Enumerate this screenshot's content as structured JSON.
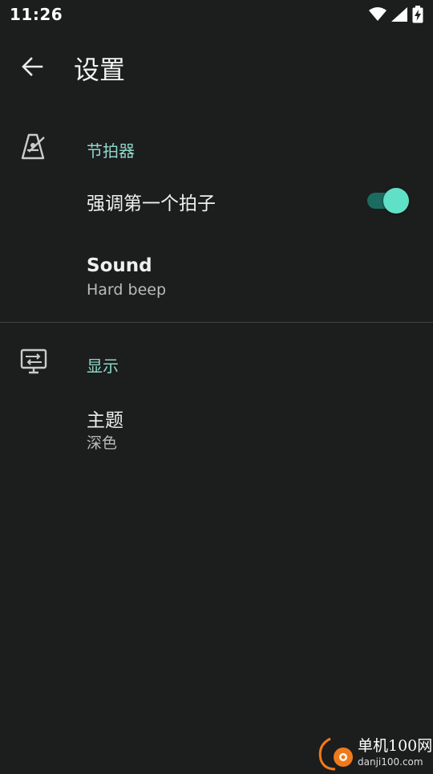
{
  "status_bar": {
    "time": "11:26",
    "icons": [
      "wifi-icon",
      "signal-icon",
      "battery-charging-icon"
    ]
  },
  "app_bar": {
    "back_icon": "arrow-back-icon",
    "title": "设置"
  },
  "sections": [
    {
      "icon": "metronome-icon",
      "title": "节拍器",
      "prefs": [
        {
          "title": "强调第一个拍子",
          "switch_on": true
        },
        {
          "title": "Sound",
          "summary": "Hard beep"
        }
      ]
    },
    {
      "icon": "display-icon",
      "title": "显示",
      "prefs": [
        {
          "title": "主题",
          "summary": "深色"
        }
      ]
    }
  ],
  "colors": {
    "background": "#1c1d1d",
    "accent": "#8fd7c6",
    "switch_thumb": "#5fe0c7",
    "switch_track": "#1c6b60",
    "divider": "#3f4242"
  },
  "watermark": {
    "main": "单机100网",
    "sub": "danji100.com"
  }
}
